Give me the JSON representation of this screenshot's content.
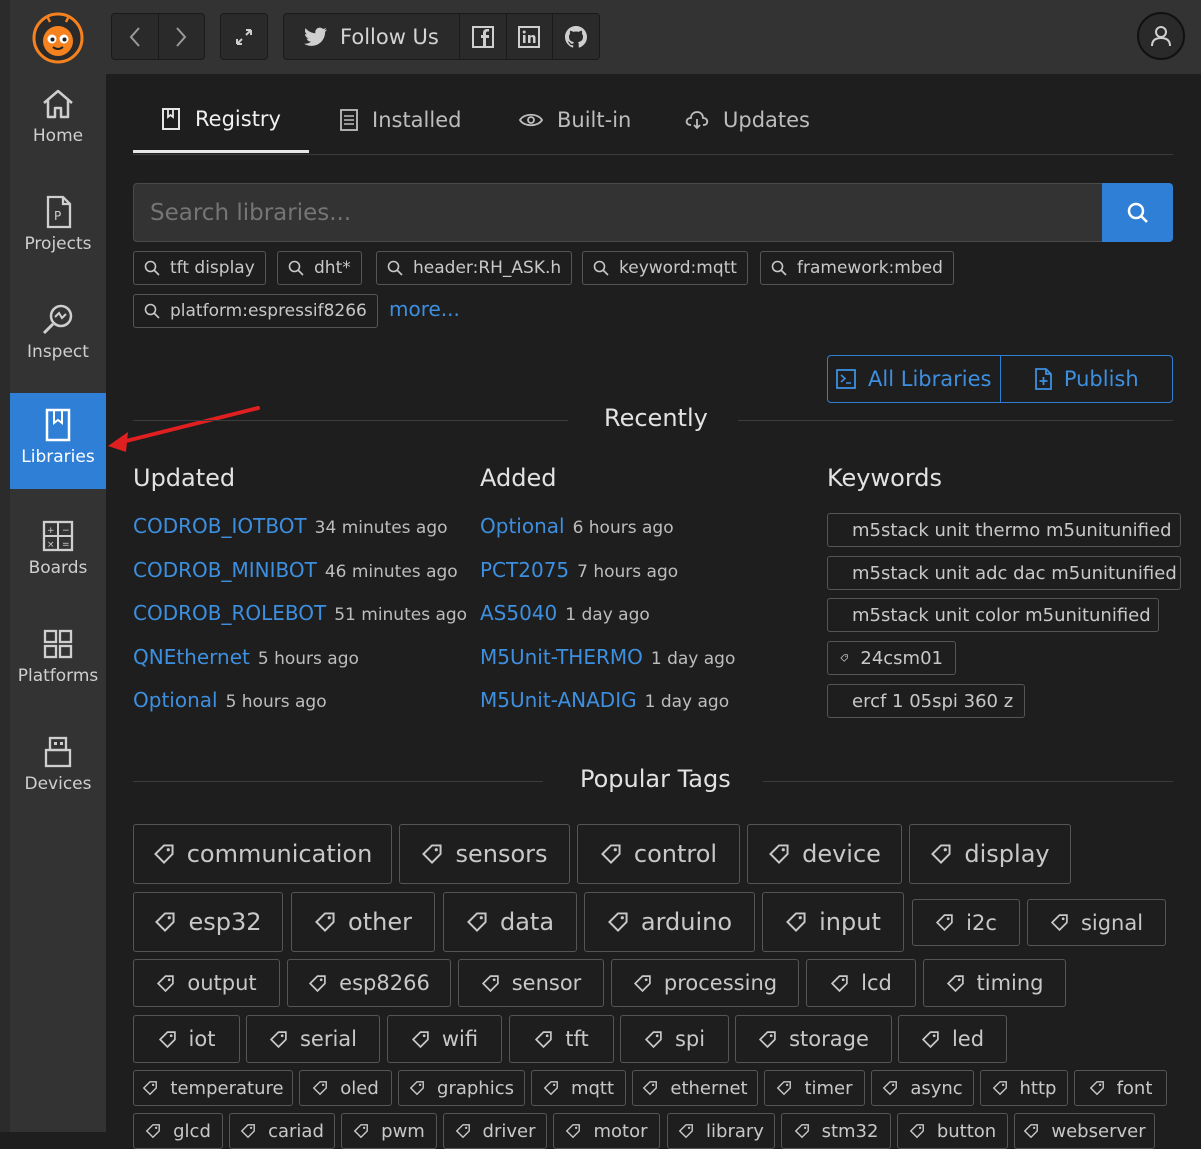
{
  "topbar": {
    "follow_label": "Follow Us"
  },
  "sidebar": {
    "items": [
      {
        "label": "Home",
        "icon": "home-icon"
      },
      {
        "label": "Projects",
        "icon": "projects-icon"
      },
      {
        "label": "Inspect",
        "icon": "inspect-icon"
      },
      {
        "label": "Libraries",
        "icon": "libraries-icon"
      },
      {
        "label": "Boards",
        "icon": "boards-icon"
      },
      {
        "label": "Platforms",
        "icon": "platforms-icon"
      },
      {
        "label": "Devices",
        "icon": "devices-icon"
      }
    ],
    "active": "Libraries"
  },
  "tabs": [
    {
      "label": "Registry",
      "icon": "book-icon",
      "active": true
    },
    {
      "label": "Installed",
      "icon": "list-icon",
      "active": false
    },
    {
      "label": "Built-in",
      "icon": "eye-icon",
      "active": false
    },
    {
      "label": "Updates",
      "icon": "cloud-download-icon",
      "active": false
    }
  ],
  "search": {
    "placeholder": "Search libraries..."
  },
  "quick_searches": [
    "tft display",
    "dht*",
    "header:RH_ASK.h",
    "keyword:mqtt",
    "framework:mbed",
    "platform:espressif8266"
  ],
  "more_link": "more...",
  "actions": {
    "all_libraries": "All Libraries",
    "publish": "Publish"
  },
  "recently": {
    "title": "Recently",
    "updated_title": "Updated",
    "added_title": "Added",
    "keywords_title": "Keywords",
    "updated": [
      {
        "name": "CODROB_IOTBOT",
        "time": "34 minutes ago"
      },
      {
        "name": "CODROB_MINIBOT",
        "time": "46 minutes ago"
      },
      {
        "name": "CODROB_ROLEBOT",
        "time": "51 minutes ago"
      },
      {
        "name": "QNEthernet",
        "time": "5 hours ago"
      },
      {
        "name": "Optional",
        "time": "5 hours ago"
      }
    ],
    "added": [
      {
        "name": "Optional",
        "time": "6 hours ago"
      },
      {
        "name": "PCT2075",
        "time": "7 hours ago"
      },
      {
        "name": "AS5040",
        "time": "1 day ago"
      },
      {
        "name": "M5Unit-THERMO",
        "time": "1 day ago"
      },
      {
        "name": "M5Unit-ANADIG",
        "time": "1 day ago"
      }
    ],
    "keywords": [
      "m5stack unit thermo m5unitunified",
      "m5stack unit adc dac m5unitunified",
      "m5stack unit color m5unitunified",
      "24csm01",
      "ercf 1 05spi 360 z"
    ]
  },
  "popular_tags": {
    "title": "Popular Tags",
    "tags": [
      "communication",
      "sensors",
      "control",
      "device",
      "display",
      "esp32",
      "other",
      "data",
      "arduino",
      "input",
      "i2c",
      "signal",
      "output",
      "esp8266",
      "sensor",
      "processing",
      "lcd",
      "timing",
      "iot",
      "serial",
      "wifi",
      "tft",
      "spi",
      "storage",
      "led",
      "temperature",
      "oled",
      "graphics",
      "mqtt",
      "ethernet",
      "timer",
      "async",
      "http",
      "font",
      "glcd",
      "cariad",
      "pwm",
      "driver",
      "motor",
      "library",
      "stm32",
      "button",
      "webserver"
    ]
  },
  "colors": {
    "accent": "#2f7fd6",
    "link": "#3d8fe0",
    "annotation_arrow": "#e02020"
  }
}
